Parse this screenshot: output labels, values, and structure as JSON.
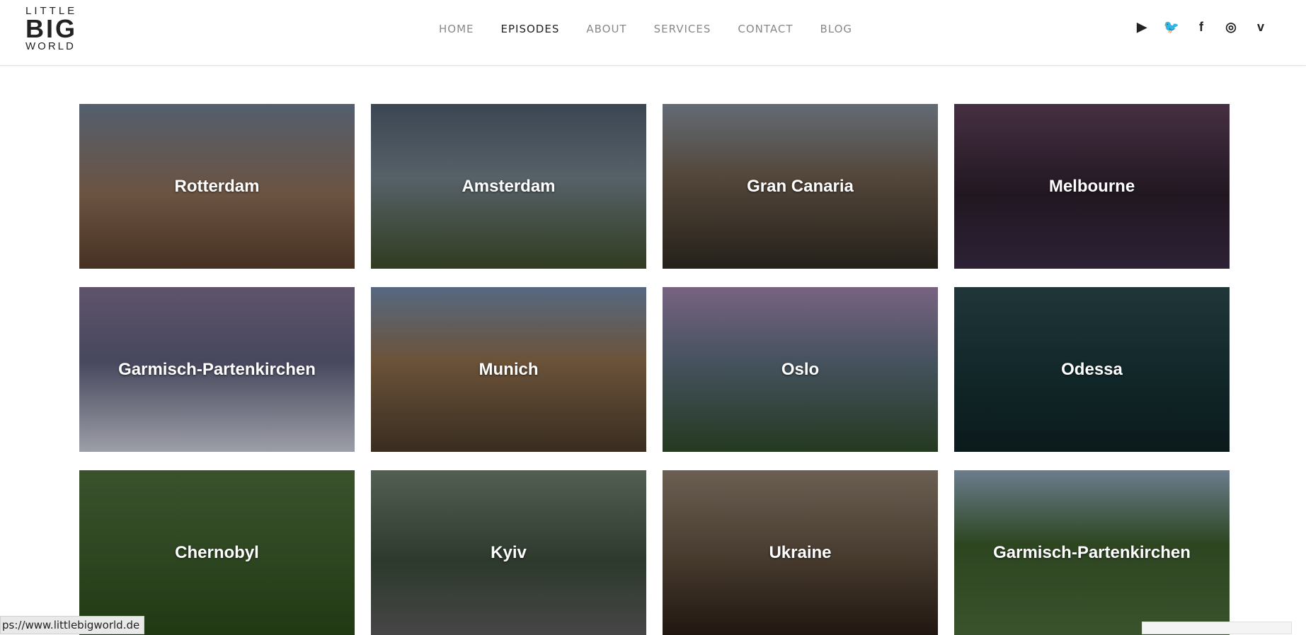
{
  "logo": {
    "line1": "LITTLE",
    "line2": "BIG",
    "line3": "WORLD"
  },
  "nav": [
    {
      "label": "HOME",
      "active": false
    },
    {
      "label": "EPISODES",
      "active": true
    },
    {
      "label": "ABOUT",
      "active": false
    },
    {
      "label": "SERVICES",
      "active": false
    },
    {
      "label": "CONTACT",
      "active": false
    },
    {
      "label": "BLOG",
      "active": false
    }
  ],
  "social": [
    {
      "name": "youtube-icon",
      "glyph": "▶"
    },
    {
      "name": "twitter-icon",
      "glyph": "🐦"
    },
    {
      "name": "facebook-icon",
      "glyph": "f"
    },
    {
      "name": "instagram-icon",
      "glyph": "◎"
    },
    {
      "name": "vimeo-icon",
      "glyph": "v"
    }
  ],
  "tiles": [
    {
      "label": "Rotterdam",
      "bg": "linear-gradient(180deg,#6c7a8d 0%,#8a6b55 55%,#5a3f2c 100%)"
    },
    {
      "label": "Amsterdam",
      "bg": "linear-gradient(180deg,#4d5a6b 0%,#6f7d86 45%,#3f4d2a 100%)"
    },
    {
      "label": "Gran Canaria",
      "bg": "linear-gradient(180deg,#7f8a96 0%,#6b5a4a 45%,#2f2a22 100%)"
    },
    {
      "label": "Melbourne",
      "bg": "linear-gradient(180deg,#5a3d55 0%,#2b1e2b 55%,#3a2b45 100%)"
    },
    {
      "label": "Garmisch-Partenkirchen",
      "bg": "linear-gradient(180deg,#7a6b8a 0%,#5b5c78 45%,#c9cbd6 100%)"
    },
    {
      "label": "Munich",
      "bg": "linear-gradient(180deg,#6f86a6 0%,#8a6a4a 45%,#4a3a2a 100%)"
    },
    {
      "label": "Oslo",
      "bg": "linear-gradient(180deg,#9a7fa6 0%,#5a6a7a 45%,#2f4a2a 100%)"
    },
    {
      "label": "Odessa",
      "bg": "linear-gradient(180deg,#2a4548 0%,#163234 55%,#0f2224 100%)"
    },
    {
      "label": "Chernobyl",
      "bg": "linear-gradient(180deg,#4a6a3a 0%,#3a5a2a 55%,#2a4a1a 100%)"
    },
    {
      "label": "Kyiv",
      "bg": "linear-gradient(180deg,#6a7a6a 0%,#3a4a3a 55%,#5a5a5a 100%)"
    },
    {
      "label": "Ukraine",
      "bg": "linear-gradient(180deg,#8a7a6a 0%,#5a4a3a 55%,#2a1e16 100%)"
    },
    {
      "label": "Garmisch-Partenkirchen",
      "bg": "linear-gradient(180deg,#8aa0b6 0%,#3a5a2a 45%,#4a6a3a 100%)"
    }
  ],
  "status_url": "ps://www.littlebigworld.de"
}
